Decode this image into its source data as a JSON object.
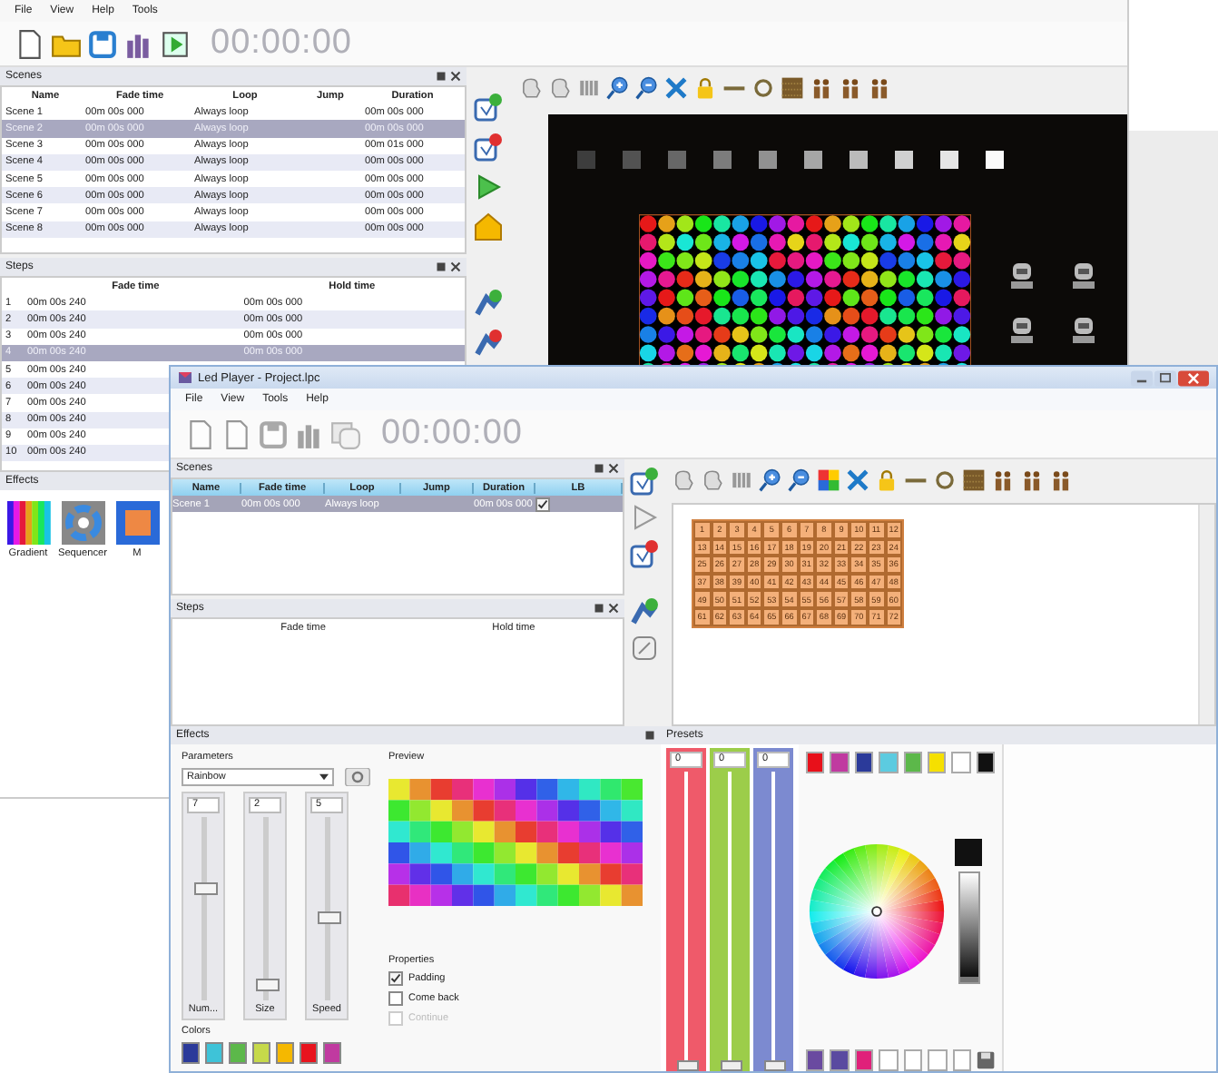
{
  "back_window": {
    "menu": [
      "File",
      "View",
      "Help",
      "Tools"
    ],
    "timer": "00:00:00",
    "scenes": {
      "title": "Scenes",
      "columns": [
        "Name",
        "Fade time",
        "Loop",
        "Jump",
        "Duration"
      ],
      "rows": [
        {
          "name": "Scene 1",
          "fade_time": "00m 00s 000",
          "loop": "Always loop",
          "duration": "00m 00s 000",
          "selected": false
        },
        {
          "name": "Scene 2",
          "fade_time": "00m 00s 000",
          "loop": "Always loop",
          "duration": "00m 00s 000",
          "selected": true
        },
        {
          "name": "Scene 3",
          "fade_time": "00m 00s 000",
          "loop": "Always loop",
          "duration": "00m 01s 000",
          "selected": false
        },
        {
          "name": "Scene 4",
          "fade_time": "00m 00s 000",
          "loop": "Always loop",
          "duration": "00m 00s 000",
          "selected": false
        },
        {
          "name": "Scene 5",
          "fade_time": "00m 00s 000",
          "loop": "Always loop",
          "duration": "00m 00s 000",
          "selected": false
        },
        {
          "name": "Scene 6",
          "fade_time": "00m 00s 000",
          "loop": "Always loop",
          "duration": "00m 00s 000",
          "selected": false
        },
        {
          "name": "Scene 7",
          "fade_time": "00m 00s 000",
          "loop": "Always loop",
          "duration": "00m 00s 000",
          "selected": false
        },
        {
          "name": "Scene 8",
          "fade_time": "00m 00s 000",
          "loop": "Always loop",
          "duration": "00m 00s 000",
          "selected": false
        }
      ]
    },
    "steps": {
      "title": "Steps",
      "columns": [
        "Fade time",
        "Hold time"
      ],
      "rows": [
        {
          "index": "1",
          "fade_time": "00m 00s 240",
          "hold_time": "00m 00s 000",
          "selected": false
        },
        {
          "index": "2",
          "fade_time": "00m 00s 240",
          "hold_time": "00m 00s 000",
          "selected": false
        },
        {
          "index": "3",
          "fade_time": "00m 00s 240",
          "hold_time": "00m 00s 000",
          "selected": false
        },
        {
          "index": "4",
          "fade_time": "00m 00s 240",
          "hold_time": "00m 00s 000",
          "selected": true
        },
        {
          "index": "5",
          "fade_time": "00m 00s 240",
          "selected": false
        },
        {
          "index": "6",
          "fade_time": "00m 00s 240",
          "selected": false
        },
        {
          "index": "7",
          "fade_time": "00m 00s 240",
          "selected": false
        },
        {
          "index": "8",
          "fade_time": "00m 00s 240",
          "selected": false
        },
        {
          "index": "9",
          "fade_time": "00m 00s 240",
          "selected": false
        },
        {
          "index": "10",
          "fade_time": "00m 00s 240",
          "selected": false
        }
      ]
    },
    "effects": {
      "title": "Effects",
      "items": [
        {
          "label": "Gradient",
          "kind": "gradient"
        },
        {
          "label": "Sequencer",
          "kind": "sequencer"
        },
        {
          "label": "M",
          "kind": "other"
        }
      ]
    }
  },
  "front_window": {
    "title": "Led Player - Project.lpc",
    "menu": [
      "File",
      "View",
      "Tools",
      "Help"
    ],
    "timer": "00:00:00",
    "scenes": {
      "title": "Scenes",
      "columns": [
        "Name",
        "Fade time",
        "Loop",
        "Jump",
        "Duration",
        "LB"
      ],
      "rows": [
        {
          "name": "Scene 1",
          "fade_time": "00m 00s 000",
          "loop": "Always loop",
          "duration": "00m 00s 000",
          "checked": true,
          "selected": true
        }
      ]
    },
    "steps": {
      "title": "Steps",
      "columns": [
        "Fade time",
        "Hold time"
      ]
    },
    "fixture_grid": [
      "1",
      "2",
      "3",
      "4",
      "5",
      "6",
      "7",
      "8",
      "9",
      "10",
      "11",
      "12",
      "13",
      "14",
      "15",
      "16",
      "17",
      "18",
      "19",
      "20",
      "21",
      "22",
      "23",
      "24",
      "25",
      "26",
      "27",
      "28",
      "29",
      "30",
      "31",
      "32",
      "33",
      "34",
      "35",
      "36",
      "37",
      "38",
      "39",
      "40",
      "41",
      "42",
      "43",
      "44",
      "45",
      "46",
      "47",
      "48",
      "49",
      "50",
      "51",
      "52",
      "53",
      "54",
      "55",
      "56",
      "57",
      "58",
      "59",
      "60",
      "61",
      "62",
      "63",
      "64",
      "65",
      "66",
      "67",
      "68",
      "69",
      "70",
      "71",
      "72"
    ],
    "effects": {
      "title": "Effects",
      "parameters_label": "Parameters",
      "effect": "Rainbow",
      "sliders": [
        {
          "value": "7",
          "label": "Num...",
          "level": 0.6
        },
        {
          "value": "2",
          "label": "Size",
          "level": 0.08
        },
        {
          "value": "5",
          "label": "Speed",
          "level": 0.45
        }
      ],
      "colors_label": "Colors",
      "colors": [
        {
          "color": "#2b3a9a"
        },
        {
          "color": "#3ec3d8"
        },
        {
          "color": "#5cb84a"
        },
        {
          "color": "#c6d94a"
        },
        {
          "color": "#f5b800"
        },
        {
          "color": "#e8141e"
        },
        {
          "color": "#c03aa0"
        }
      ],
      "preview_label": "Preview",
      "properties_label": "Properties",
      "properties": [
        {
          "label": "Padding",
          "checked": true,
          "disabled": false
        },
        {
          "label": "Come back",
          "checked": false,
          "disabled": false
        },
        {
          "label": "Continue",
          "checked": false,
          "disabled": true
        }
      ]
    },
    "presets": {
      "title": "Presets",
      "brightness": {
        "level": 0
      },
      "sliders": [
        {
          "value": "0",
          "color": "#ef5a6a",
          "level": 0
        },
        {
          "value": "0",
          "color": "#9ccd4a",
          "level": 0
        },
        {
          "value": "0",
          "color": "#7c8ad0",
          "level": 0
        }
      ],
      "top_swatches": [
        {
          "color": "#e8101a"
        },
        {
          "color": "#c03aa0"
        },
        {
          "color": "#2b3a9a"
        },
        {
          "color": "#5ccbe0"
        },
        {
          "color": "#5cb84a"
        },
        {
          "color": "#f5e000"
        },
        {
          "color": "#ffffff"
        },
        {
          "color": "#111111"
        }
      ],
      "bottom_swatches": [
        {
          "color": "#6a4aa0"
        },
        {
          "color": "#5a4aa0"
        },
        {
          "color": "#e0207a"
        },
        {
          "color": "#ffffff"
        },
        {
          "color": "#ffffff"
        },
        {
          "color": "#ffffff"
        },
        {
          "color": "#ffffff"
        }
      ]
    }
  }
}
